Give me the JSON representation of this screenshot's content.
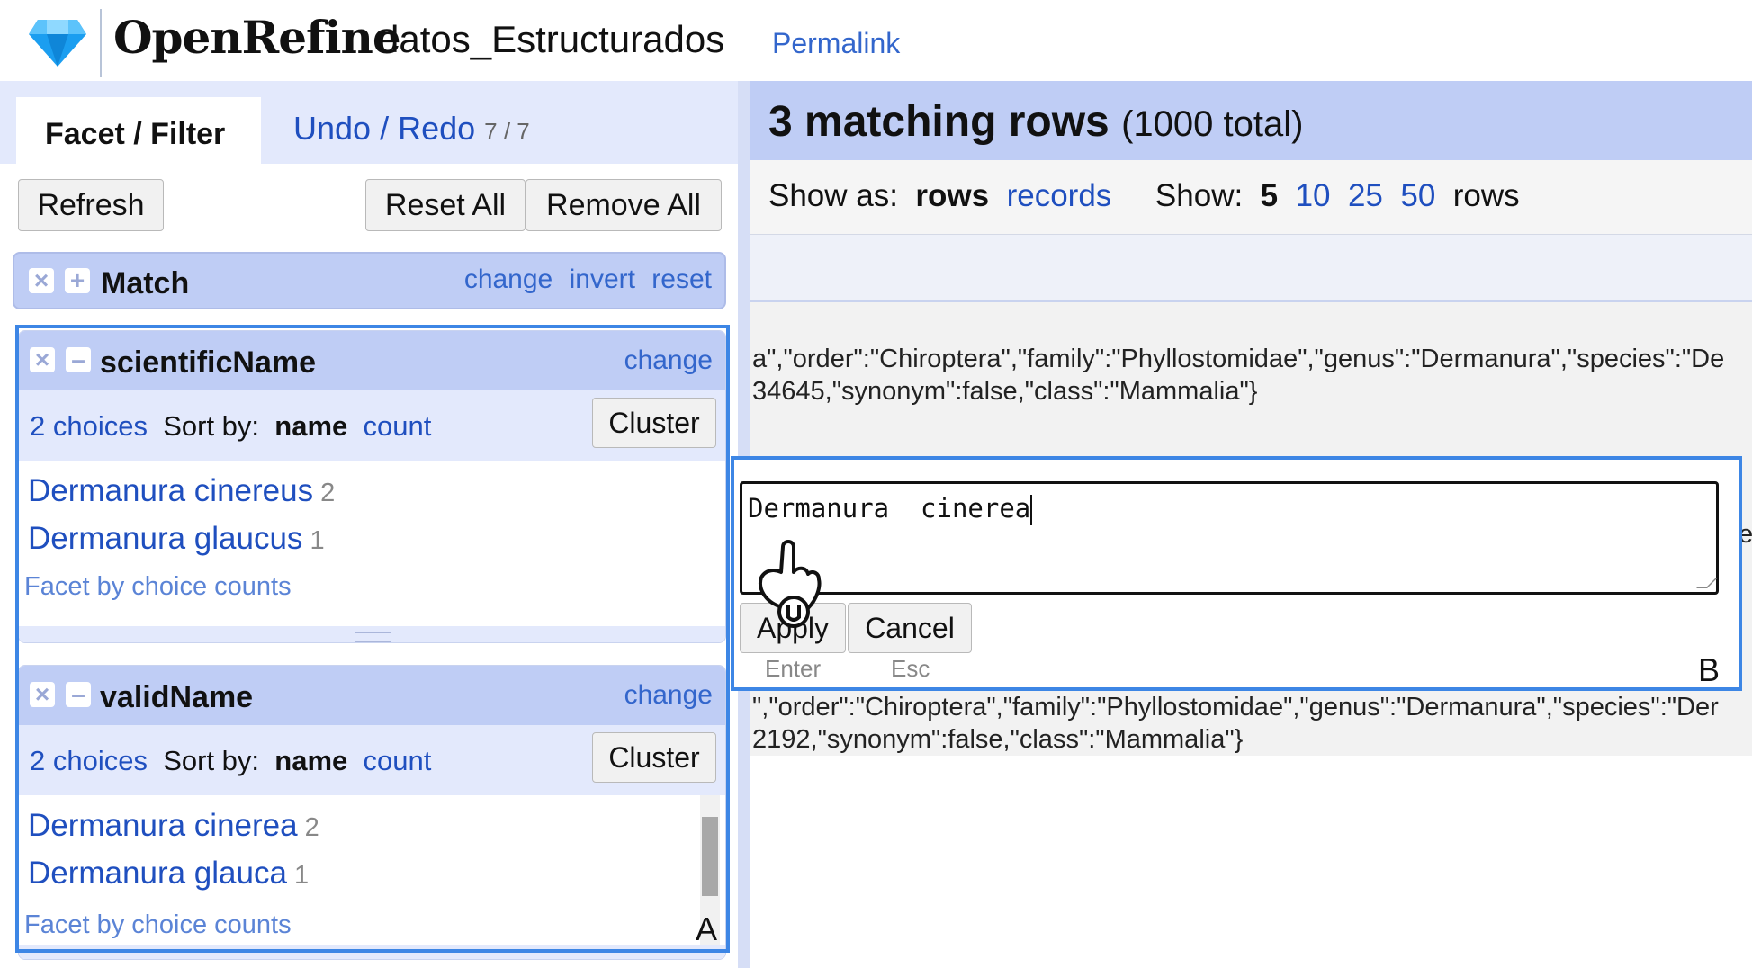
{
  "header": {
    "brand": "OpenRefine",
    "project_name": "datos_Estructurados",
    "permalink": "Permalink"
  },
  "left_panel": {
    "tabs": {
      "facet_filter": "Facet / Filter",
      "undo_redo": "Undo / Redo",
      "undo_count": "7 / 7"
    },
    "buttons": {
      "refresh": "Refresh",
      "reset_all": "Reset All",
      "remove_all": "Remove All"
    },
    "match_facet": {
      "title": "Match",
      "links": [
        "change",
        "invert",
        "reset"
      ]
    },
    "facets": [
      {
        "title": "scientificName",
        "change_label": "change",
        "choices_label": "2 choices",
        "sort_by": "Sort by:",
        "sort_name": "name",
        "sort_count": "count",
        "cluster": "Cluster",
        "choices": [
          {
            "name": "Dermanura cinereus",
            "count": "2"
          },
          {
            "name": "Dermanura glaucus",
            "count": "1"
          }
        ],
        "facet_by_counts": "Facet by choice counts"
      },
      {
        "title": "validName",
        "change_label": "change",
        "choices_label": "2 choices",
        "sort_by": "Sort by:",
        "sort_name": "name",
        "sort_count": "count",
        "cluster": "Cluster",
        "choices": [
          {
            "name": "Dermanura cinerea",
            "count": "2"
          },
          {
            "name": "Dermanura glauca",
            "count": "1"
          }
        ],
        "facet_by_counts": "Facet by choice counts"
      }
    ],
    "annotation_label": "A"
  },
  "right_panel": {
    "matching_count": "3 matching rows",
    "total": "(1000 total)",
    "show_as_label": "Show as:",
    "show_as_rows": "rows",
    "show_as_records": "records",
    "show_label": "Show:",
    "page_sizes": [
      "5",
      "10",
      "25",
      "50"
    ],
    "rows_suffix": "rows",
    "json_row1_line1": "a\",\"order\":\"Chiroptera\",\"family\":\"Phyllostomidae\",\"genus\":\"Dermanura\",\"species\":\"De",
    "json_row1_line2": "34645,\"synonym\":false,\"class\":\"Mammalia\"}",
    "json_row2_line1": "\",\"order\":\"Chiroptera\",\"family\":\"Phyllostomidae\",\"genus\":\"Dermanura\",\"species\":\"Der",
    "json_row2_line2": "2192,\"synonym\":false,\"class\":\"Mammalia\"}",
    "edge_char": "e"
  },
  "edit_popup": {
    "value": "Dermanura  cinerea",
    "apply": "Apply",
    "apply_key": "Enter",
    "cancel": "Cancel",
    "cancel_key": "Esc",
    "annotation_label": "B"
  },
  "colors": {
    "facet_header": "#bfcdf5",
    "panel_bg": "#e3e9fc",
    "link": "#1f4fbf",
    "highlight_outline": "#3d86e5"
  }
}
